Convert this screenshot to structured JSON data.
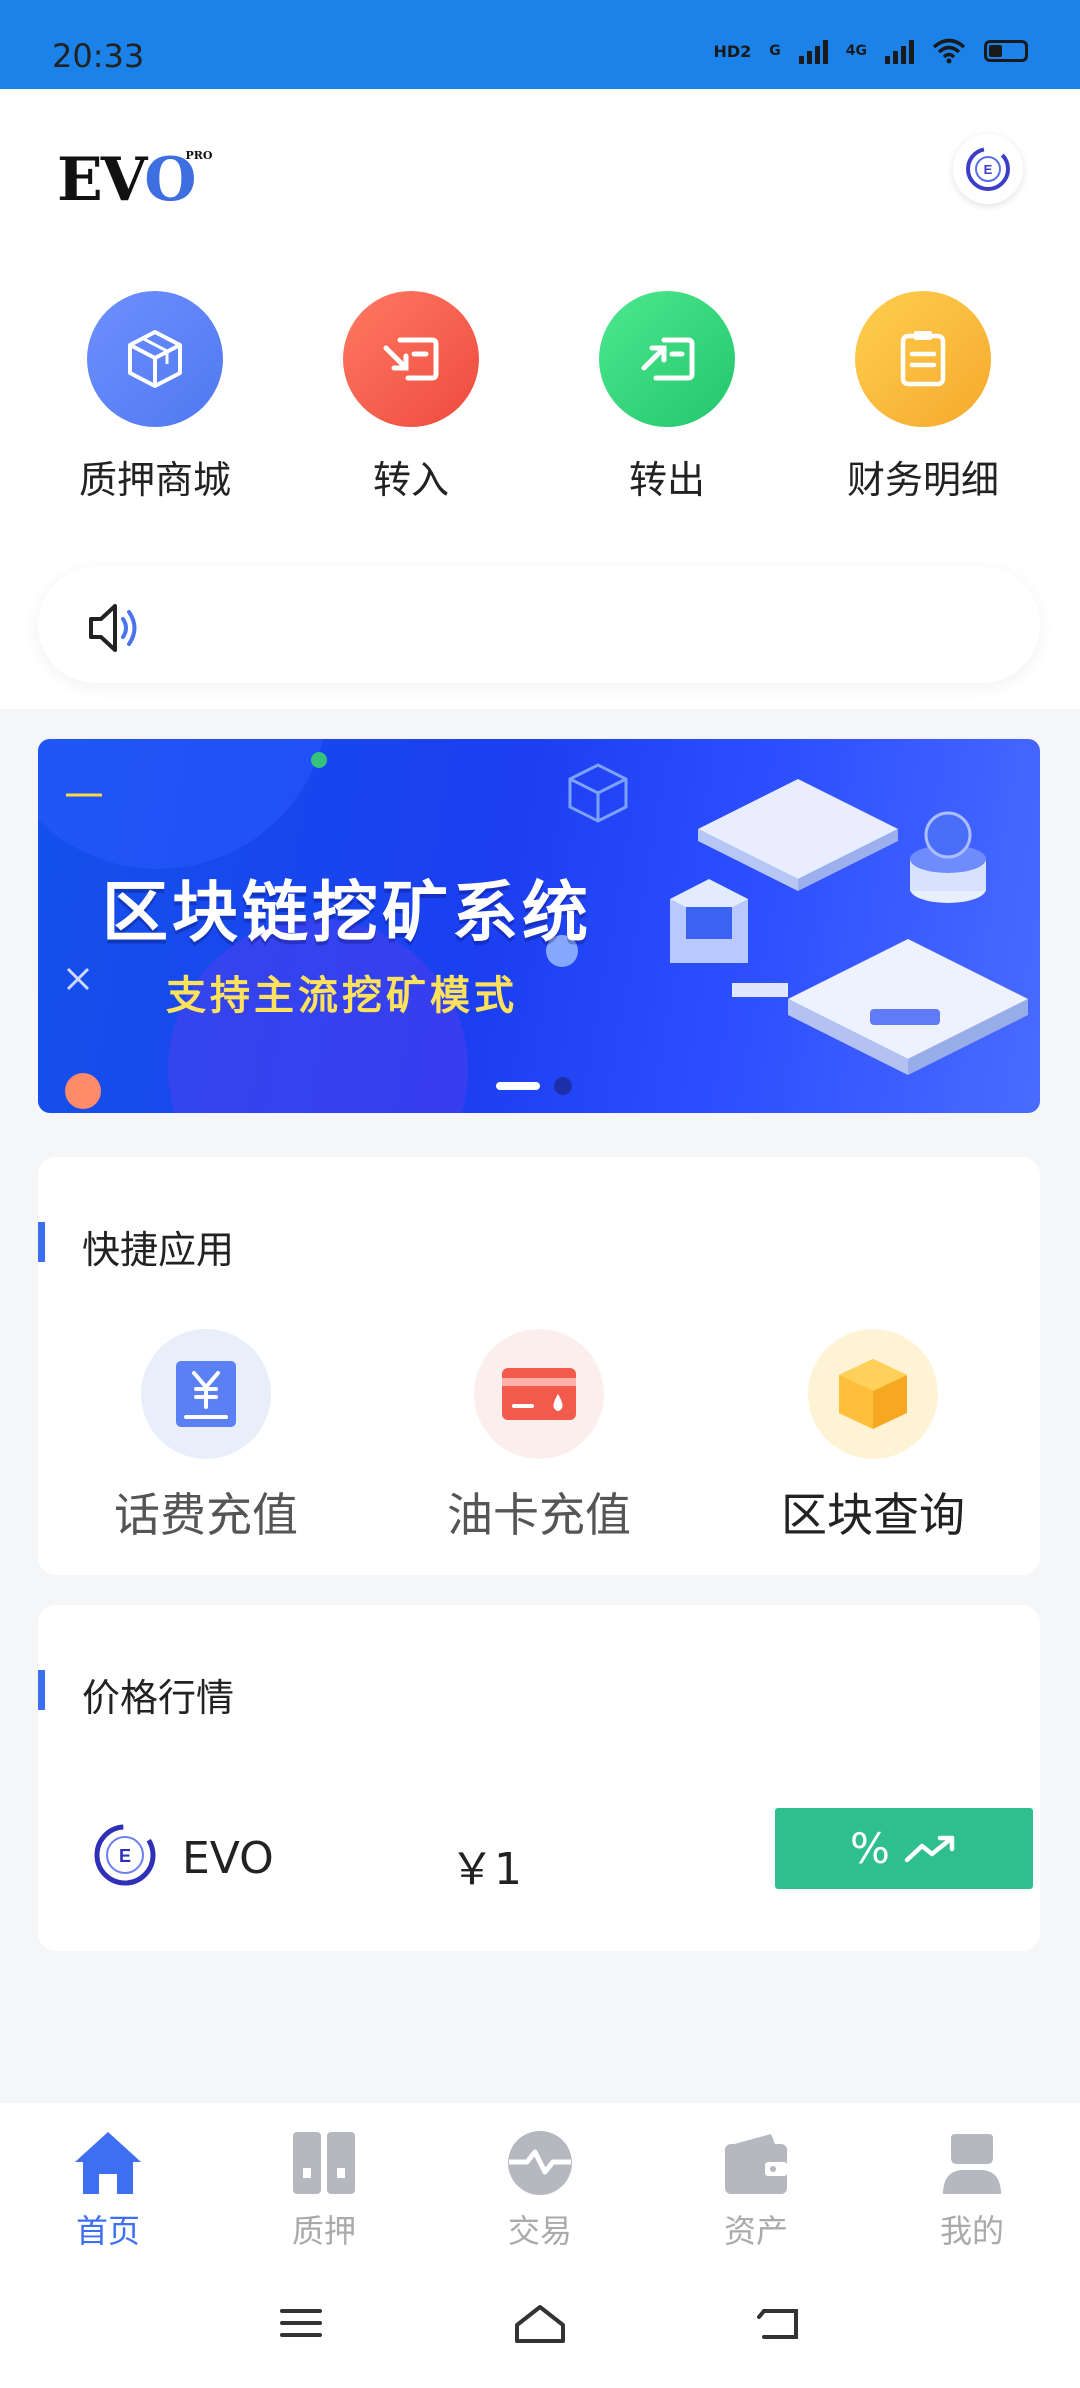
{
  "status_bar": {
    "time": "20:33",
    "tag_hd": "HD2",
    "tag_g": "G",
    "tag_4g": "4G",
    "battery_level": 0.35
  },
  "header": {
    "logo_text": "EV",
    "logo_o": "O",
    "logo_pro": "PRO",
    "avatar_icon": "evo-coin-icon"
  },
  "menu": [
    {
      "label": "质押商城",
      "icon": "box-icon",
      "color": "#5b7ff5"
    },
    {
      "label": "转入",
      "icon": "transfer-in-icon",
      "color": "#f2584c"
    },
    {
      "label": "转出",
      "icon": "transfer-out-icon",
      "color": "#2fd37a"
    },
    {
      "label": "财务明细",
      "icon": "document-icon",
      "color": "#f7b93a"
    }
  ],
  "notice": {
    "icon": "speaker-icon"
  },
  "banner": {
    "title": "区块链挖矿系统",
    "subtitle": "支持主流挖矿模式",
    "slides": 2,
    "active_slide": 1
  },
  "quick_apps": {
    "title": "快捷应用",
    "items": [
      {
        "label": "话费充值",
        "icon": "yuan-bill-icon"
      },
      {
        "label": "油卡充值",
        "icon": "fuel-card-icon"
      },
      {
        "label": "区块查询",
        "icon": "cube-icon"
      }
    ]
  },
  "market": {
    "title": "价格行情",
    "rows": [
      {
        "name": "EVO",
        "price": "￥1",
        "change": "%",
        "trend_icon": "trend-up-icon",
        "color": "#2fbf8e"
      }
    ]
  },
  "tabbar": [
    {
      "label": "首页",
      "icon": "home-icon",
      "active": true
    },
    {
      "label": "质押",
      "icon": "pledge-icon",
      "active": false
    },
    {
      "label": "交易",
      "icon": "trade-icon",
      "active": false
    },
    {
      "label": "资产",
      "icon": "wallet-icon",
      "active": false
    },
    {
      "label": "我的",
      "icon": "user-icon",
      "active": false
    }
  ],
  "colors": {
    "accent": "#3f6ff1",
    "statusbar": "#1b82ea",
    "inactive_tab": "#aaaaaa"
  }
}
